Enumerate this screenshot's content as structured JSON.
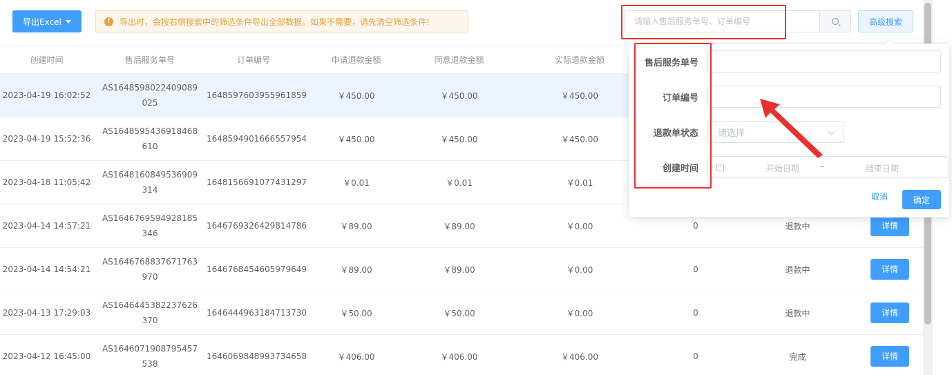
{
  "toolbar": {
    "export_label": "导出Excel",
    "notice_text": "导出时，会按右侧搜索中的筛选条件导出全部数据。如果不需要，请先清空筛选条件!",
    "search_placeholder": "请输入售后服务单号、订单编号",
    "advanced_search_label": "高级搜索"
  },
  "table": {
    "headers": [
      "创建时间",
      "售后服务单号",
      "订单编号",
      "申请退款金额",
      "同意退款金额",
      "实际退款金额"
    ],
    "detail_label": "详情",
    "rows": [
      {
        "created": "2023-04-19 16:02:52",
        "service_no_line1": "AS1648598022409089",
        "service_no_line2": "025",
        "order_no": "1648597603955961859",
        "apply": "￥450.00",
        "agree": "￥450.00",
        "actual": "￥450.00",
        "count": "",
        "status": ""
      },
      {
        "created": "2023-04-19 15:52:36",
        "service_no_line1": "AS1648595436918468",
        "service_no_line2": "610",
        "order_no": "1648594901666557954",
        "apply": "￥450.00",
        "agree": "￥450.00",
        "actual": "￥450.00",
        "count": "",
        "status": ""
      },
      {
        "created": "2023-04-18 11:05:42",
        "service_no_line1": "AS1648160849536909",
        "service_no_line2": "314",
        "order_no": "1648156691077431297",
        "apply": "￥0.01",
        "agree": "￥0.01",
        "actual": "￥0.01",
        "count": "",
        "status": ""
      },
      {
        "created": "2023-04-14 14:57:21",
        "service_no_line1": "AS1646769594928185",
        "service_no_line2": "346",
        "order_no": "1646769326429814786",
        "apply": "￥89.00",
        "agree": "￥89.00",
        "actual": "￥0.00",
        "count": "0",
        "status": "退款中"
      },
      {
        "created": "2023-04-14 14:54:21",
        "service_no_line1": "AS1646768837671763",
        "service_no_line2": "970",
        "order_no": "1646768454605979649",
        "apply": "￥89.00",
        "agree": "￥89.00",
        "actual": "￥0.00",
        "count": "0",
        "status": "退款中"
      },
      {
        "created": "2023-04-13 17:29:03",
        "service_no_line1": "AS1646445382237626",
        "service_no_line2": "370",
        "order_no": "1646444963184713730",
        "apply": "￥50.00",
        "agree": "￥50.00",
        "actual": "￥0.00",
        "count": "0",
        "status": "退款中"
      },
      {
        "created": "2023-04-12 16:45:00",
        "service_no_line1": "AS1646071908795457",
        "service_no_line2": "538",
        "order_no": "1646069848993734658",
        "apply": "￥406.00",
        "agree": "￥406.00",
        "actual": "￥406.00",
        "count": "0",
        "status": "完成"
      }
    ]
  },
  "advanced_search": {
    "service_no_label": "售后服务单号",
    "order_no_label": "订单编号",
    "refund_status_label": "退款单状态",
    "refund_status_placeholder": "请选择",
    "created_label": "创建时间",
    "start_date_placeholder": "开始日期",
    "date_separator": "-",
    "end_date_placeholder": "结束日期",
    "cancel_label": "取消",
    "confirm_label": "确定"
  },
  "colors": {
    "primary": "#409eff",
    "annotation_red": "#e8302f",
    "warning": "#e6a23c"
  }
}
